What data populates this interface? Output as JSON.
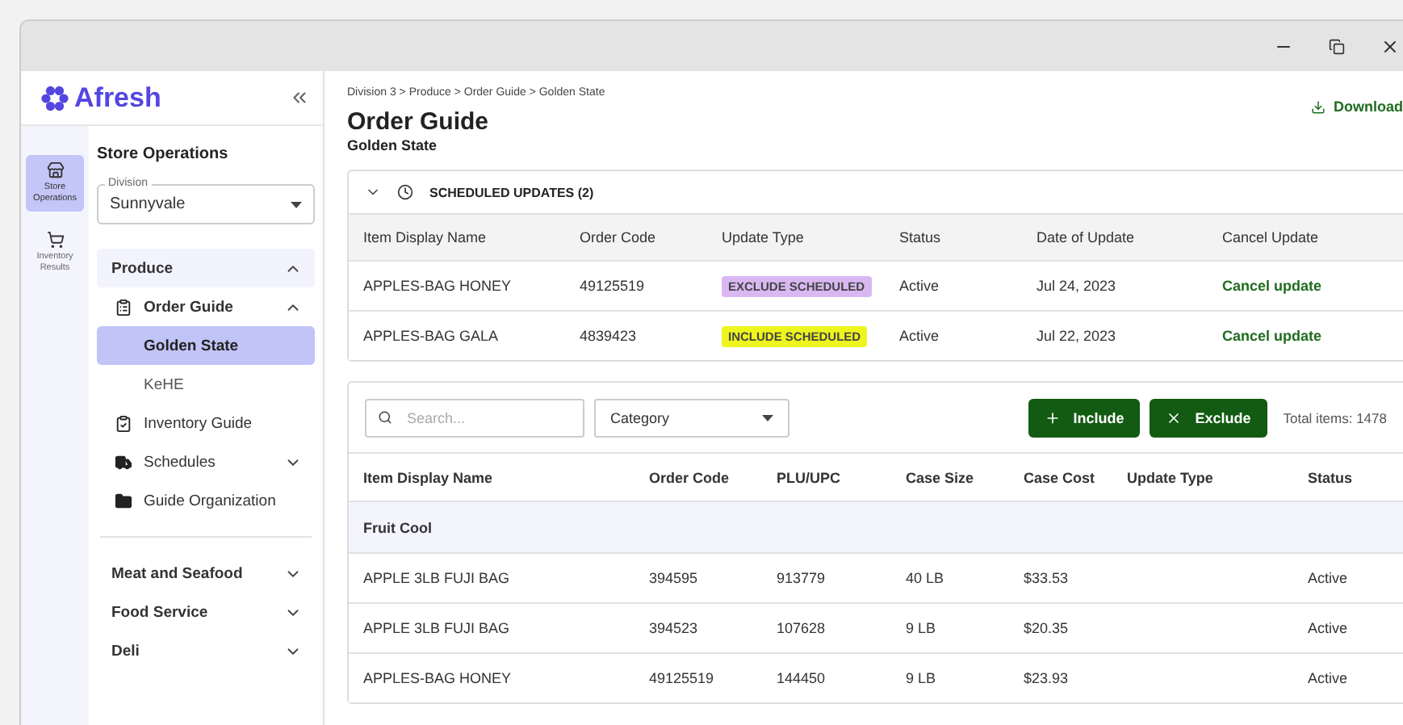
{
  "sidebar": {
    "logo": "Afresh",
    "rail": [
      {
        "label": "Store Operations",
        "selected": true
      },
      {
        "label": "Inventory Results",
        "selected": false
      }
    ],
    "section_title": "Store Operations",
    "division": {
      "label": "Division",
      "value": "Sunnyvale"
    },
    "groups": [
      {
        "label": "Produce",
        "selected": true,
        "expanded": true,
        "children": [
          {
            "label": "Order Guide",
            "expanded": true,
            "children": [
              {
                "label": "Golden State",
                "selected": true
              },
              {
                "label": "KeHE",
                "selected": false
              }
            ]
          },
          {
            "label": "Inventory Guide"
          },
          {
            "label": "Schedules",
            "expanded": false
          },
          {
            "label": "Guide Organization"
          }
        ]
      },
      {
        "label": "Meat and Seafood",
        "selected": false,
        "expanded": false
      },
      {
        "label": "Food Service",
        "selected": false,
        "expanded": false
      },
      {
        "label": "Deli",
        "selected": false,
        "expanded": false
      }
    ]
  },
  "breadcrumb": "Division 3 > Produce > Order Guide > Golden State",
  "download": "Download",
  "title": "Order Guide",
  "subtitle": "Golden State",
  "scheduled": {
    "title": "SCHEDULED UPDATES (2)",
    "expanded": true,
    "columns": [
      "Item Display Name",
      "Order Code",
      "Update Type",
      "Status",
      "Date of Update",
      "Cancel Update"
    ],
    "rows": [
      {
        "name": "APPLES-BAG HONEY",
        "code": "49125519",
        "update_type": "EXCLUDE SCHEDULED",
        "color": "#d9b8f2",
        "status": "Active",
        "date": "Jul 24, 2023",
        "action": "Cancel update"
      },
      {
        "name": "APPLES-BAG GALA",
        "code": "4839423",
        "update_type": "INCLUDE SCHEDULED",
        "color": "#eef51e",
        "status": "Active",
        "date": "Jul 22, 2023",
        "action": "Cancel update"
      }
    ]
  },
  "items": {
    "search": {
      "placeholder": "Search..."
    },
    "category": "Category",
    "include": "Include",
    "exclude": "Exclude",
    "total": "Total items: 1478",
    "columns": [
      "Item Display Name",
      "Order Code",
      "PLU/UPC",
      "Case Size",
      "Case Cost",
      "Update Type",
      "Status"
    ],
    "rows": [
      {
        "kind": "group",
        "label": "Fruit Cool"
      },
      {
        "kind": "item",
        "cells": [
          "APPLE 3LB FUJI BAG",
          "394595",
          "913779",
          "40 LB",
          "$33.53",
          "",
          "Active"
        ]
      },
      {
        "kind": "item",
        "cells": [
          "APPLE 3LB FUJI BAG",
          "394523",
          "107628",
          "9 LB",
          "$20.35",
          "",
          "Active"
        ]
      },
      {
        "kind": "item",
        "cells": [
          "APPLES-BAG HONEY",
          "49125519",
          "144450",
          "9 LB",
          "$23.93",
          "",
          "Active"
        ]
      }
    ]
  }
}
